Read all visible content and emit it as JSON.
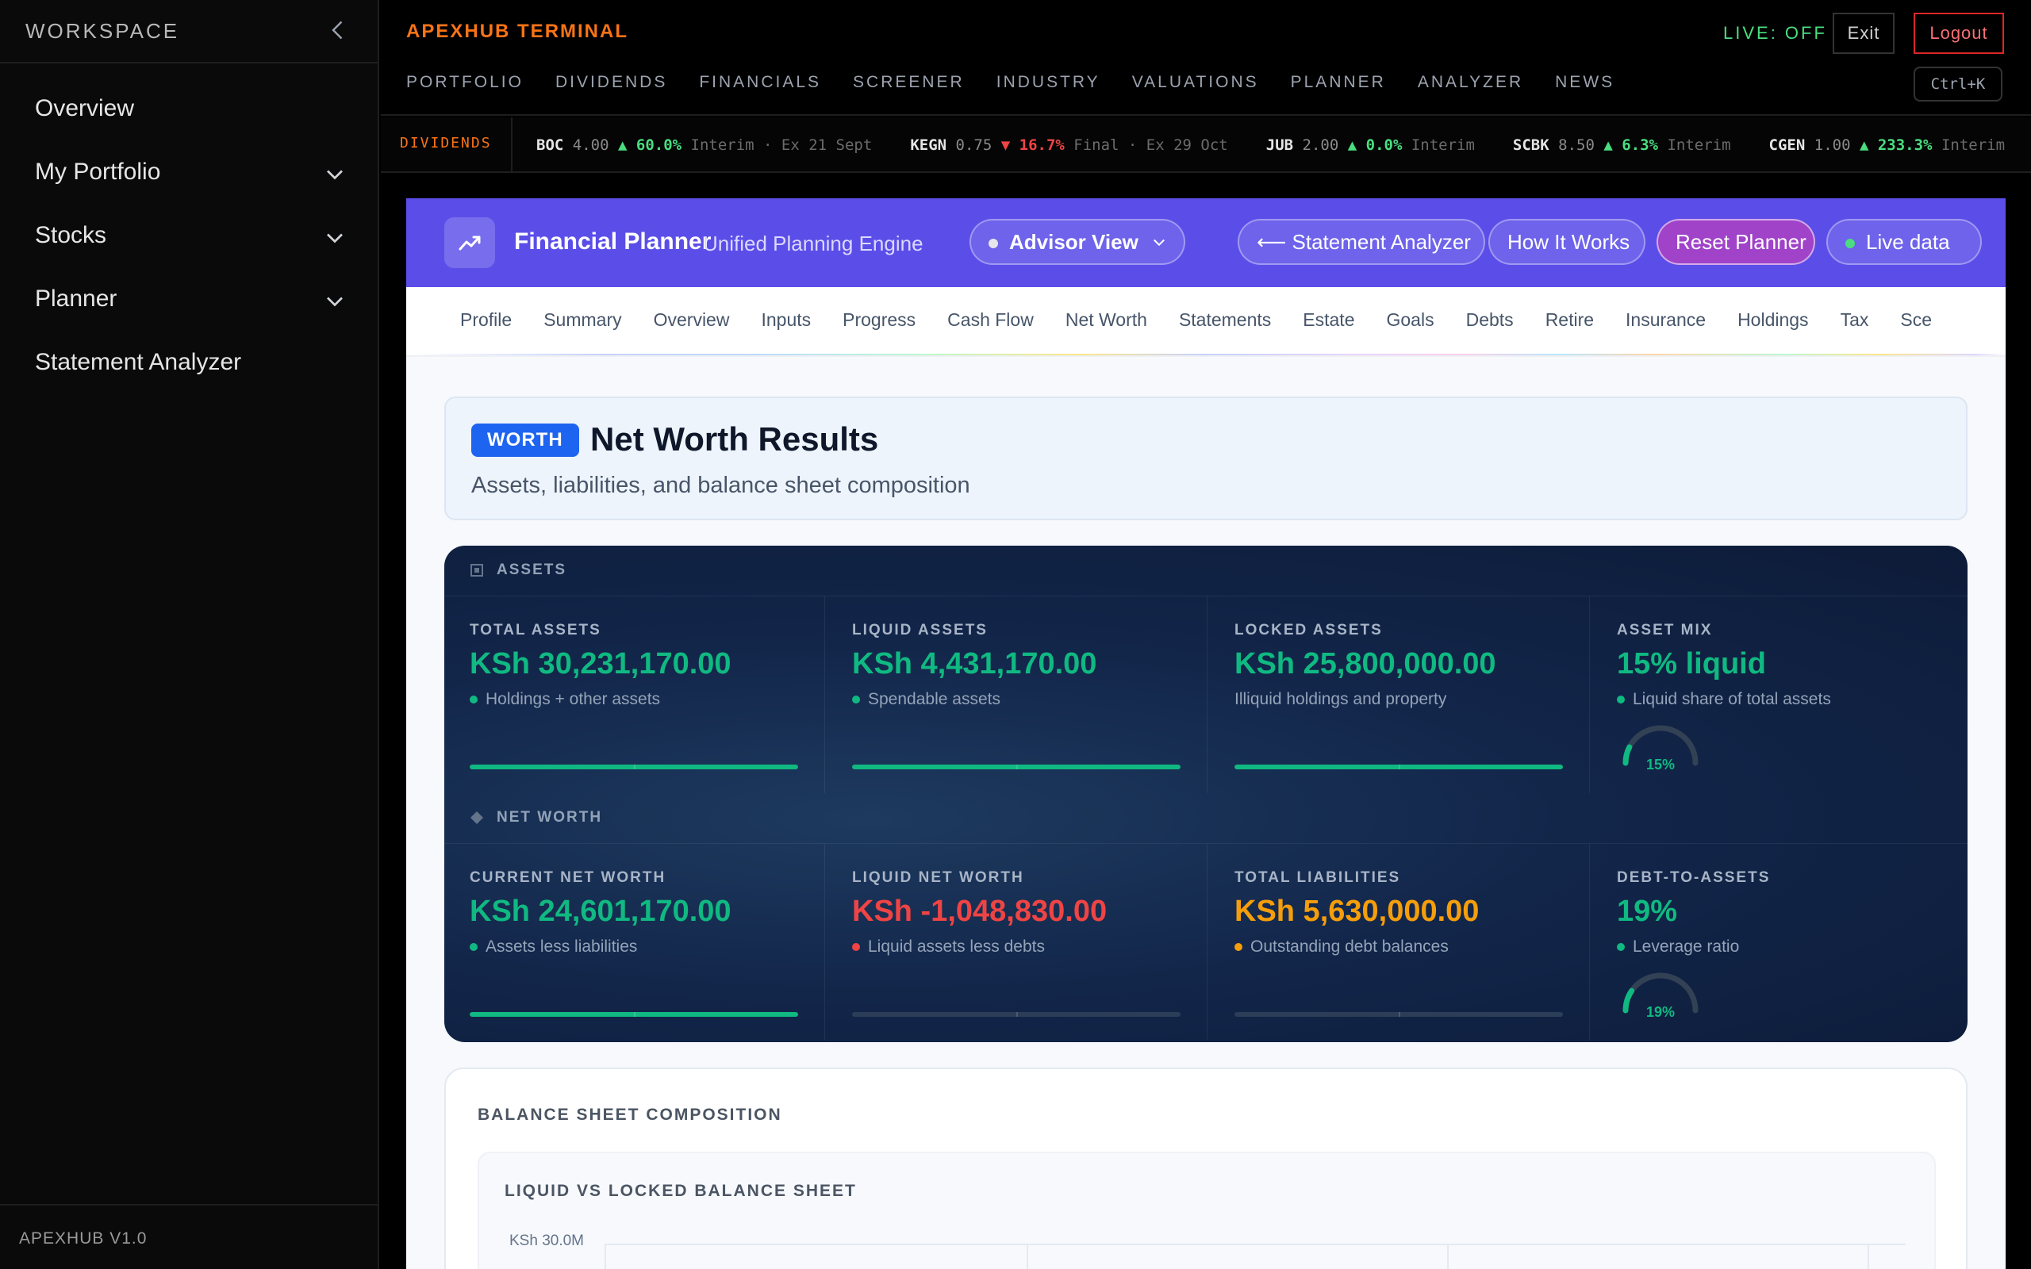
{
  "sidebar": {
    "title": "WORKSPACE",
    "items": [
      {
        "label": "Overview"
      },
      {
        "label": "My Portfolio"
      },
      {
        "label": "Stocks"
      },
      {
        "label": "Planner"
      },
      {
        "label": "Statement Analyzer"
      }
    ],
    "version": "APEXHUB V1.0"
  },
  "header": {
    "brand": "APEXHUB TERMINAL",
    "nav": [
      "PORTFOLIO",
      "DIVIDENDS",
      "FINANCIALS",
      "SCREENER",
      "INDUSTRY",
      "VALUATIONS",
      "PLANNER",
      "ANALYZER",
      "NEWS"
    ],
    "live_status": "LIVE: OFF",
    "exit_label": "Exit",
    "logout_label": "Logout",
    "shortcut": "Ctrl+K"
  },
  "ticker": {
    "label": "DIVIDENDS",
    "items": [
      {
        "symbol": "BOC",
        "price": "4.00",
        "change": "▲ 60.0%",
        "meta": "Interim · Ex 21 Sept",
        "dir": "up"
      },
      {
        "symbol": "KEGN",
        "price": "0.75",
        "change": "▼ 16.7%",
        "meta": "Final · Ex 29 Oct",
        "dir": "down"
      },
      {
        "symbol": "JUB",
        "price": "2.00",
        "change": "▲ 0.0%",
        "meta": "Interim",
        "dir": "up"
      },
      {
        "symbol": "SCBK",
        "price": "8.50",
        "change": "▲ 6.3%",
        "meta": "Interim",
        "dir": "up"
      },
      {
        "symbol": "CGEN",
        "price": "1.00",
        "change": "▲ 233.3%",
        "meta": "Interim",
        "dir": "up"
      }
    ]
  },
  "planner": {
    "title": "Financial Planner",
    "subtitle": "Unified Planning Engine",
    "view_select": "Advisor View",
    "buttons": {
      "analyzer": "⟵ Statement Analyzer",
      "how": "How It Works",
      "reset": "Reset Planner",
      "live": "Live data"
    },
    "tabs": [
      "Profile",
      "Summary",
      "Overview",
      "Inputs",
      "Progress",
      "Cash Flow",
      "Net Worth",
      "Statements",
      "Estate",
      "Goals",
      "Debts",
      "Retire",
      "Insurance",
      "Holdings",
      "Tax",
      "Sce"
    ]
  },
  "networth": {
    "badge": "WORTH",
    "title": "Net Worth Results",
    "subtitle": "Assets, liabilities, and balance sheet composition",
    "sections": [
      {
        "title": "ASSETS",
        "icon": "square-icon",
        "cards": [
          {
            "label": "TOTAL ASSETS",
            "value": "KSh 30,231,170.00",
            "note": "Holdings + other assets",
            "tone": "green",
            "dot": "#10b981",
            "fill": 1.0
          },
          {
            "label": "LIQUID ASSETS",
            "value": "KSh 4,431,170.00",
            "note": "Spendable assets",
            "tone": "green",
            "dot": "#10b981",
            "fill": 1.0
          },
          {
            "label": "LOCKED ASSETS",
            "value": "KSh 25,800,000.00",
            "note": "Illiquid holdings and property",
            "tone": "green",
            "dot": "",
            "fill": 1.0
          },
          {
            "label": "ASSET MIX",
            "value": "15% liquid",
            "note": "Liquid share of total assets",
            "tone": "green",
            "dot": "#10b981",
            "gauge": 0.15,
            "gauge_label": "15%"
          }
        ]
      },
      {
        "title": "NET WORTH",
        "icon": "diamond-icon",
        "cards": [
          {
            "label": "CURRENT NET WORTH",
            "value": "KSh 24,601,170.00",
            "note": "Assets less liabilities",
            "tone": "green",
            "dot": "#10b981",
            "fill": 1.0
          },
          {
            "label": "LIQUID NET WORTH",
            "value": "KSh -1,048,830.00",
            "note": "Liquid assets less debts",
            "tone": "red",
            "dot": "#ef4444",
            "fill": 0
          },
          {
            "label": "TOTAL LIABILITIES",
            "value": "KSh 5,630,000.00",
            "note": "Outstanding debt balances",
            "tone": "amber",
            "dot": "#f59e0b",
            "fill": 0
          },
          {
            "label": "DEBT-TO-ASSETS",
            "value": "19%",
            "note": "Leverage ratio",
            "tone": "green",
            "dot": "#10b981",
            "gauge": 0.19,
            "gauge_label": "19%"
          }
        ]
      }
    ]
  },
  "balance_sheet": {
    "title": "BALANCE SHEET COMPOSITION",
    "chart_title": "LIQUID VS LOCKED BALANCE SHEET",
    "y_tick": "KSh 30.0M"
  },
  "colors": {
    "accent": "#5b4ee8",
    "brand": "#f97316",
    "positive": "#10b981",
    "negative": "#ef4444",
    "warning": "#f59e0b"
  }
}
